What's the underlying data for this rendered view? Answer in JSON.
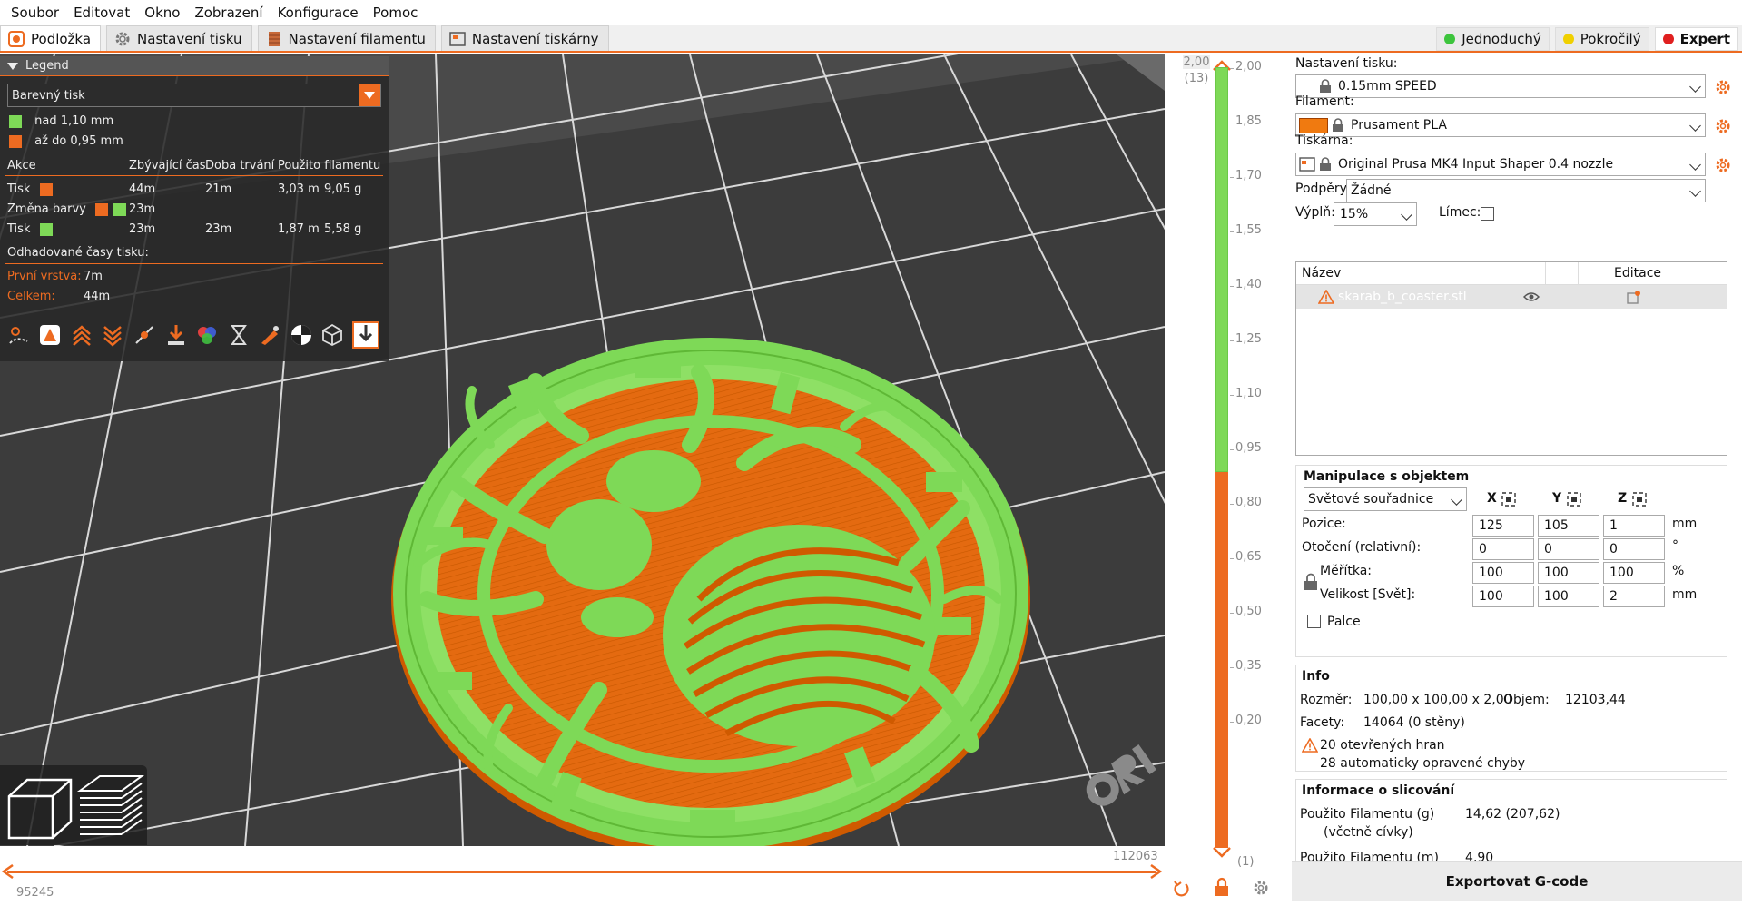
{
  "menu": [
    "Soubor",
    "Editovat",
    "Okno",
    "Zobrazení",
    "Konfigurace",
    "Pomoc"
  ],
  "tabs": [
    {
      "label": "Podložka",
      "active": true
    },
    {
      "label": "Nastavení tisku",
      "active": false
    },
    {
      "label": "Nastavení filamentu",
      "active": false
    },
    {
      "label": "Nastavení tiskárny",
      "active": false
    }
  ],
  "modes": [
    {
      "label": "Jednoduchý",
      "color": "#3cc43c",
      "active": false
    },
    {
      "label": "Pokročilý",
      "color": "#f0d000",
      "active": false
    },
    {
      "label": "Expert",
      "color": "#e02020",
      "active": true
    }
  ],
  "legend": {
    "title": "Legend",
    "view_type": "Barevný tisk",
    "color_items": [
      {
        "color": "#7ed957",
        "label": "nad 1,10 mm"
      },
      {
        "color": "#ed6b21",
        "label": "až do 0,95 mm"
      }
    ],
    "columns": [
      "Akce",
      "Zbývající čas",
      "Doba trvání",
      "Použito filamentu"
    ],
    "rows": [
      {
        "action": "Tisk",
        "remaining": "44m",
        "duration": "21m",
        "length": "3,03 m",
        "weight": "9,05 g"
      },
      {
        "action": "Změna barvy",
        "remaining": "23m",
        "duration": "",
        "length": "",
        "weight": ""
      },
      {
        "action": "Tisk",
        "remaining": "23m",
        "duration": "23m",
        "length": "1,87 m",
        "weight": "5,58 g"
      }
    ],
    "estimates_title": "Odhadované časy tisku:",
    "first_layer_label": "První vrstva:",
    "first_layer_value": "7m",
    "total_label": "Celkem:",
    "total_value": "44m"
  },
  "h_slider": {
    "lower": "95245",
    "upper": "112063"
  },
  "v_slider": {
    "top_value": "2,00",
    "top_layer": "(13)",
    "bottom_value": "0,20",
    "bottom_layer": "(1)",
    "ticks": [
      "2,00",
      "1,85",
      "1,70",
      "1,55",
      "1,40",
      "1,25",
      "1,10",
      "0,95",
      "0,80",
      "0,65",
      "0,50",
      "0,35",
      "0,20"
    ],
    "change_at": "1,10"
  },
  "right": {
    "print_settings_label": "Nastavení tisku:",
    "print_profile": "0.15mm SPEED",
    "filament_label": "Filament:",
    "filament_profile": "Prusament PLA",
    "filament_color": "#f07a10",
    "printer_label": "Tiskárna:",
    "printer_profile": "Original Prusa MK4 Input Shaper 0.4 nozzle",
    "supports_label": "Podpěry:",
    "supports_value": "Žádné",
    "infill_label": "Výplň:",
    "infill_value": "15%",
    "brim_label": "Límec:",
    "objects_header_name": "Název",
    "objects_header_edit": "Editace",
    "object_name": "skarab_b_coaster.stl",
    "manip_title": "Manipulace s objektem",
    "coord_system": "Světové souřadnice",
    "axis_x": "X",
    "axis_y": "Y",
    "axis_z": "Z",
    "position_label": "Pozice:",
    "position": [
      "125",
      "105",
      "1"
    ],
    "position_unit": "mm",
    "rotation_label": "Otočení (relativní):",
    "rotation": [
      "0",
      "0",
      "0"
    ],
    "rotation_unit": "°",
    "scale_label": "Měřítka:",
    "scale": [
      "100",
      "100",
      "100"
    ],
    "scale_unit": "%",
    "size_label": "Velikost [Svět]:",
    "size": [
      "100",
      "100",
      "2"
    ],
    "size_unit": "mm",
    "inches_label": "Palce",
    "info_title": "Info",
    "dims_label": "Rozměr:",
    "dims_value": "100,00 x 100,00 x 2,00",
    "volume_label": "Objem:",
    "volume_value": "12103,44",
    "facets_label": "Facety:",
    "facets_value": "14064 (0 stěny)",
    "open_edges": "20 otevřených hran",
    "auto_repaired": "28 automaticky opravené chyby",
    "slice_title": "Informace o slicování",
    "filament_used_g_label": "Použito Filamentu (g)",
    "filament_used_g_sub": "(včetně cívky)",
    "filament_used_g_value": "14,62 (207,62)",
    "filament_used_m_label": "Použito Filamentu (m)",
    "filament_used_m_value": "4,90",
    "export_label": "Exportovat G-code"
  }
}
